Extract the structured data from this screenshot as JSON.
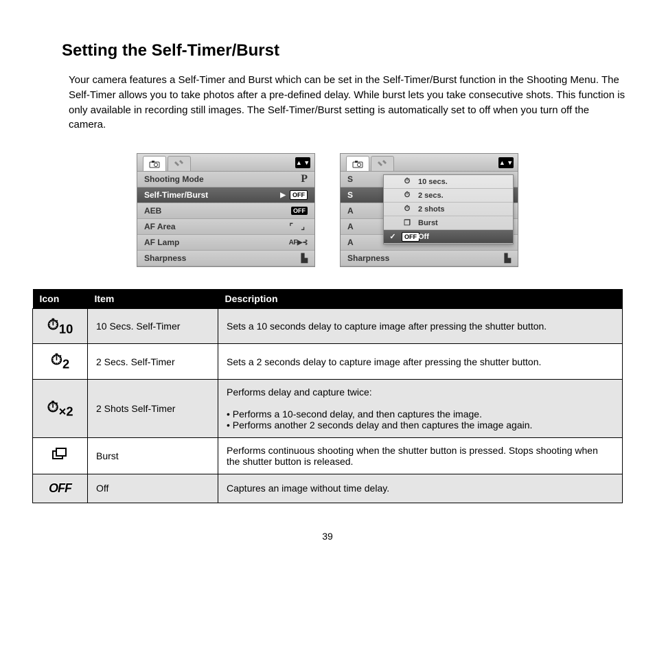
{
  "title": "Setting the Self-Timer/Burst",
  "intro": "Your camera features a Self-Timer and Burst which can be set in the Self-Timer/Burst function in the Shooting Menu. The Self-Timer allows you to take photos after a pre-defined delay. While burst lets you take consecutive shots. This function is only available in recording still images. The Self-Timer/Burst setting is automatically set to off when you turn off the camera.",
  "menu": {
    "shooting_mode": "Shooting Mode",
    "self_timer_burst": "Self-Timer/Burst",
    "aeb": "AEB",
    "af_area": "AF Area",
    "af_lamp": "AF Lamp",
    "sharpness": "Sharpness",
    "off_badge": "OFF",
    "p_value": "P",
    "aflamp_value": "AF▶⊰"
  },
  "popup": {
    "opt_10": "10 secs.",
    "opt_2": "2 secs.",
    "opt_2shots": "2 shots",
    "opt_burst": "Burst",
    "opt_off": "Off",
    "check": "✓"
  },
  "table": {
    "h_icon": "Icon",
    "h_item": "Item",
    "h_desc": "Description",
    "rows": [
      {
        "item": "10 Secs. Self-Timer",
        "desc": "Sets a 10 seconds delay to capture image after pressing the shutter button."
      },
      {
        "item": "2 Secs. Self-Timer",
        "desc": "Sets a 2 seconds delay to capture image after pressing the shutter button."
      },
      {
        "item": "2 Shots Self-Timer",
        "desc": "Performs delay and capture twice:\n\n• Performs a 10-second delay, and then captures the image.\n• Performs another 2 seconds delay and then captures the image again."
      },
      {
        "item": "Burst",
        "desc": "Performs continuous shooting when the shutter button is pressed. Stops shooting when the shutter button is released."
      },
      {
        "item": "Off",
        "desc": "Captures an image without time delay."
      }
    ],
    "off_text": "OFF"
  },
  "icons": {
    "timer10": "⏱10",
    "timer2": "⏱2",
    "timer2shots": "⏱×2",
    "burst": "❐",
    "sub10": "10",
    "sub2": "2",
    "subx2": "×2"
  },
  "pagenum": "39"
}
